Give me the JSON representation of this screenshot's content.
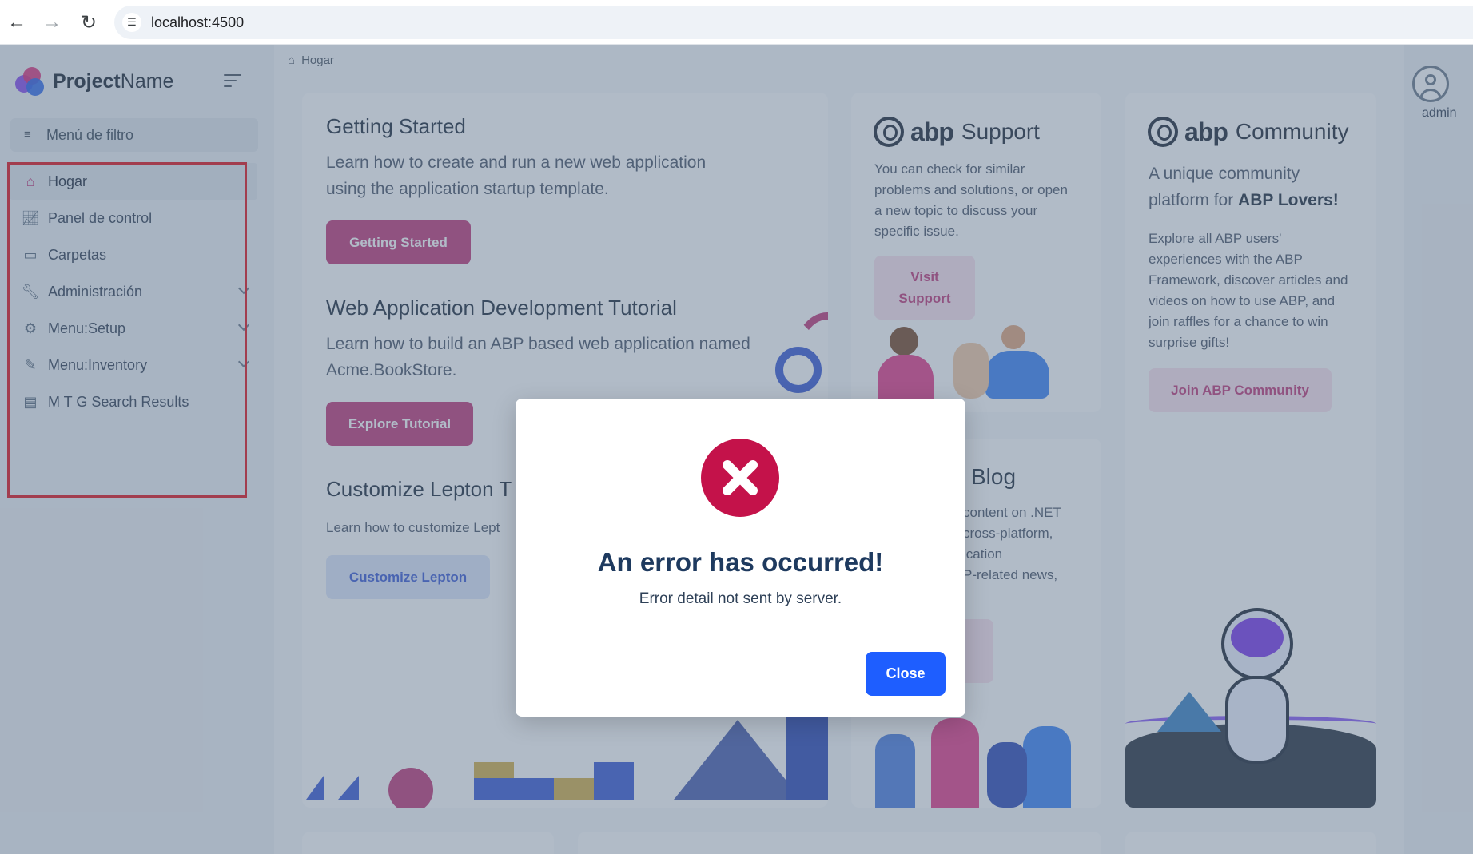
{
  "browser": {
    "url": "localhost:4500"
  },
  "brand": {
    "name_bold": "Project",
    "name_rest": "Name"
  },
  "sidebar": {
    "filter_label": "Menú de filtro",
    "items": [
      {
        "label": "Hogar",
        "icon": "home-icon",
        "active": true
      },
      {
        "label": "Panel de control",
        "icon": "chart-icon"
      },
      {
        "label": "Carpetas",
        "icon": "folder-icon"
      },
      {
        "label": "Administración",
        "icon": "wrench-icon",
        "expandable": true
      },
      {
        "label": "Menu:Setup",
        "icon": "gear-icon",
        "expandable": true
      },
      {
        "label": "Menu:Inventory",
        "icon": "edit-icon",
        "expandable": true
      },
      {
        "label": "M T G Search Results",
        "icon": "document-icon"
      }
    ]
  },
  "breadcrumb": {
    "home": "Hogar"
  },
  "cards": {
    "getting_started": {
      "title": "Getting Started",
      "text": "Learn how to create and run a new web application using the application startup template.",
      "button": "Getting Started"
    },
    "tutorial": {
      "title": "Web Application Development Tutorial",
      "text": "Learn how to build an ABP based web application named Acme.BookStore.",
      "button": "Explore Tutorial"
    },
    "lepton": {
      "title": "Customize Lepton T",
      "text": "Learn how to customize Lept",
      "button": "Customize Lepton"
    },
    "support": {
      "logo_word": "abp",
      "title": "Support",
      "text": "You can check for similar problems and solutions, or open a new topic to discuss your specific issue.",
      "button": "Visit Support"
    },
    "blog": {
      "title": "Blog",
      "lines": [
        "content on .NET",
        "cross-platform,",
        "ication",
        "P-related news,"
      ]
    },
    "community": {
      "logo_word": "abp",
      "title": "Community",
      "tagline_pre": "A unique community platform for ",
      "tagline_bold": "ABP Lovers!",
      "text": "Explore all ABP users' experiences with the ABP Framework, discover articles and videos on how to use ABP, and join raffles for a chance to win surprise gifts!",
      "button": "Join ABP Community"
    }
  },
  "user": {
    "name": "admin"
  },
  "modal": {
    "title": "An error has occurred!",
    "detail": "Error detail not sent by server.",
    "close_label": "Close",
    "accent": "#c4124a",
    "button_color": "#1e5eff"
  }
}
